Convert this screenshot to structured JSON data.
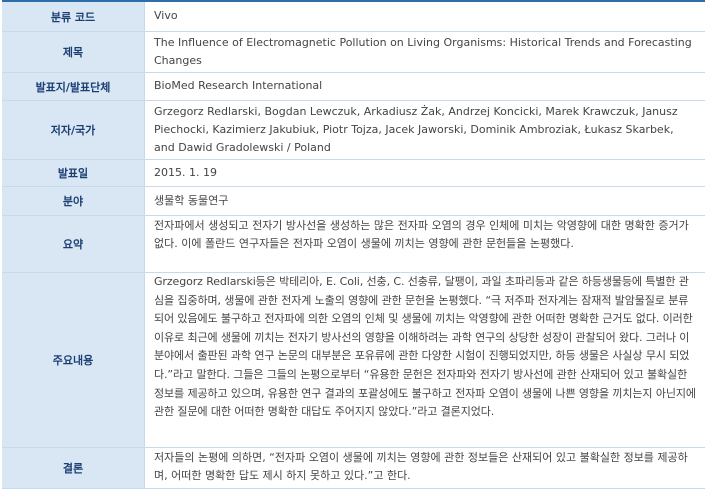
{
  "rows": [
    {
      "label": "분류 코드",
      "value": "Vivo"
    },
    {
      "label": "제목",
      "value": "The Influence of Electromagnetic Pollution on Living Organisms: Historical Trends and Forecasting Changes"
    },
    {
      "label": "발표지/발표단체",
      "value": "BioMed Research International"
    },
    {
      "label": "저자/국가",
      "value": "Grzegorz Redlarski, Bogdan Lewczuk, Arkadiusz Żak, Andrzej Koncicki, Marek Krawczuk, Janusz Piechocki, Kazimierz Jakubiuk, Piotr Tojza, Jacek Jaworski, Dominik Ambroziak, Łukasz Skarbek, and Dawid Gradolewski / Poland"
    },
    {
      "label": "발표일",
      "value": "2015. 1. 19"
    },
    {
      "label": "분야",
      "value": "생물학 동물연구"
    },
    {
      "label": "요약",
      "value": "전자파에서 생성되고 전자기 방사선을 생성하는 많은 전자파 오염의 경우 인체에 미치는 악영향에 대한 명확한 증거가 없다. 이에 폴란드 연구자들은 전자파 오염이 생물에 끼치는 영향에 관한 문헌들을 논평했다."
    },
    {
      "label": "주요내용",
      "value": "Grzegorz Redlarski등은 박테리아, E. Coli, 선충, C. 선충류, 달팽이, 과일 초파리등과 같은 하등생물등에 특별한 관심을 집중하며, 생물에 관한 전자계 노출의 영향에 관한 문헌을 논평했다. “극 저주파 전자계는 잠재적 발암물질로 분류되어 있음에도 불구하고 전자파에 의한 오염의 인체 및 생물에 끼치는 악영향에 관한 어떠한 명확한 근거도 없다. 이러한 이유로 최근에 생물에 끼치는 전자기 방사선의 영향을 이해하려는 과학 연구의 상당한 성장이 관찰되어 왔다. 그러나 이 분야에서 출판된 과학 연구 논문의 대부분은 포유류에 관한 다양한 시험이 진행되었지만, 하등 생물은 사실상 무시 되었다.”라고 말한다. 그들은 그들의 논평으로부터 “유용한 문헌은 전자파와 전자기 방사선에 관한 산재되어 있고 불확실한 정보를 제공하고 있으며, 유용한 연구 결과의 포괄성에도 불구하고 전자파 오염이 생물에 나쁜 영향을 끼치는지 아닌지에 관한 질문에 대한 어떠한 명확한 대답도 주어지지 않았다.”라고 결론지었다."
    },
    {
      "label": "결론",
      "value": "저자들의 논평에 의하면, “전자파 오염이 생물에 끼치는 영향에 관한 정보들은 산재되어 있고 불확실한 정보를 제공하며, 어떠한 명확한 답도 제시 하지 못하고 있다.”고 한다."
    }
  ]
}
